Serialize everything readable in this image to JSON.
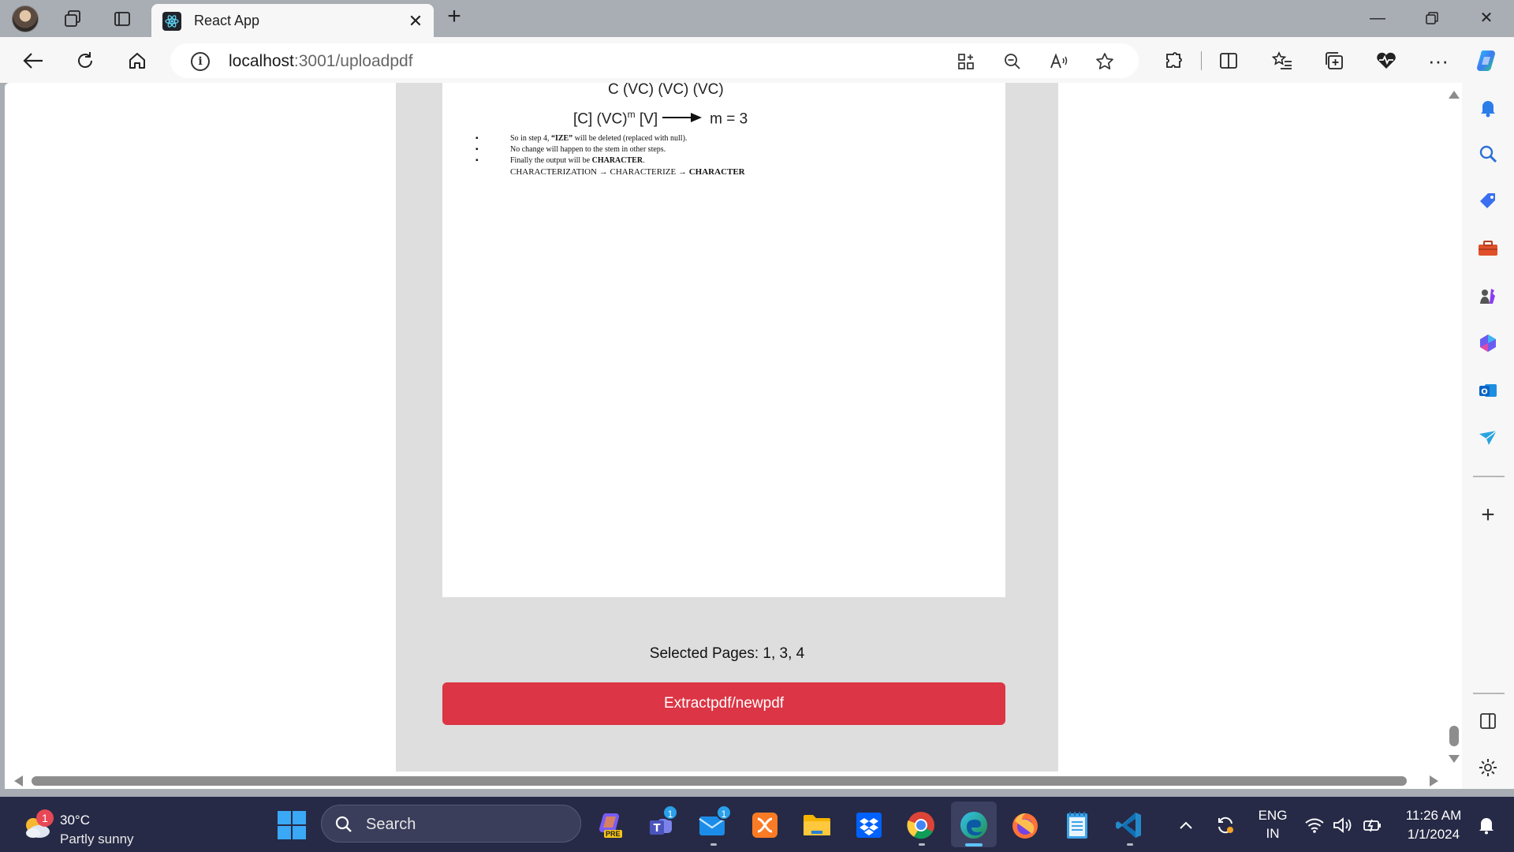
{
  "browser": {
    "tab": {
      "title": "React App"
    },
    "address": {
      "host": "localhost",
      "path": ":3001/uploadpdf"
    }
  },
  "pdf": {
    "equation_top": "C (VC) (VC) (VC)",
    "equation_main_left": "[C] (VC)",
    "equation_main_sup": "m",
    "equation_main_mid": " [V]",
    "equation_main_right": "m = 3",
    "bullets": [
      {
        "prefix": "So in step 4, ",
        "bold": "“IZE”",
        "suffix": " will be deleted (replaced with null)."
      },
      {
        "prefix": "No change will happen to the stem in other steps.",
        "bold": "",
        "suffix": ""
      },
      {
        "prefix": "Finally the output will be ",
        "bold": "CHARACTER",
        "suffix": "."
      }
    ],
    "chain_a": "CHARACTERIZATION",
    "chain_b": "CHARACTERIZE",
    "chain_c": "CHARACTER",
    "chain_arrow": "→",
    "bullet_glyph": "▪"
  },
  "app": {
    "selected_pages": "Selected Pages: 1, 3, 4",
    "extract_button": "Extractpdf/newpdf"
  },
  "taskbar": {
    "weather": {
      "temp": "30°C",
      "condition": "Partly sunny",
      "badge": "1"
    },
    "search_label": "Search",
    "teams_badge": "1",
    "mail_badge": "1",
    "copilot_badge": "PRE",
    "language": "ENG",
    "region": "IN",
    "time": "11:26 AM",
    "date": "1/1/2024"
  },
  "colors": {
    "extract_button": "#dc3545",
    "panel": "#dedede",
    "taskbar": "#262a46"
  }
}
